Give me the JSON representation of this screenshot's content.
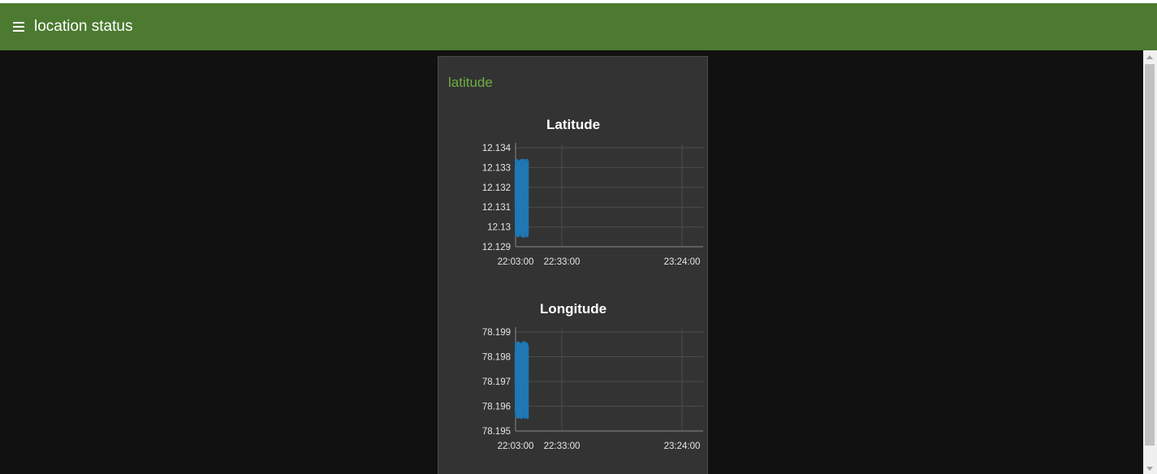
{
  "app": {
    "title": "location status",
    "header_color": "#4c7a30",
    "title_color": "#ffffff"
  },
  "card": {
    "title": "latitude",
    "title_color": "#6dae43"
  },
  "icons": {
    "menu": "hamburger-menu-icon"
  },
  "series_color": "#1f77b4",
  "chart_data": [
    {
      "type": "line",
      "title": "Latitude",
      "xlabel": "",
      "ylabel": "",
      "x_ticks": [
        "22:03:00",
        "22:33:00",
        "23:24:00"
      ],
      "x_tick_positions": [
        "22:03:00",
        "22:33:00",
        "23:24:00"
      ],
      "ylim": [
        12.129,
        12.134
      ],
      "y_ticks": [
        "12.134",
        "12.133",
        "12.132",
        "12.131",
        "12.13",
        "12.129"
      ],
      "y_tick_values": [
        12.134,
        12.133,
        12.132,
        12.131,
        12.13,
        12.129
      ],
      "grid": true,
      "series": [
        {
          "x_range": [
            "22:03:00",
            "22:11:00"
          ],
          "y_range": [
            12.1295,
            12.1334
          ]
        }
      ]
    },
    {
      "type": "line",
      "title": "Longitude",
      "xlabel": "",
      "ylabel": "",
      "x_ticks": [
        "22:03:00",
        "22:33:00",
        "23:24:00"
      ],
      "x_tick_positions": [
        "22:03:00",
        "22:33:00",
        "23:24:00"
      ],
      "ylim": [
        78.195,
        78.199
      ],
      "y_ticks": [
        "78.199",
        "78.198",
        "78.197",
        "78.196",
        "78.195"
      ],
      "y_tick_values": [
        78.199,
        78.198,
        78.197,
        78.196,
        78.195
      ],
      "grid": true,
      "series": [
        {
          "x_range": [
            "22:03:00",
            "22:11:00"
          ],
          "y_range": [
            78.1955,
            78.1986
          ]
        }
      ]
    }
  ]
}
